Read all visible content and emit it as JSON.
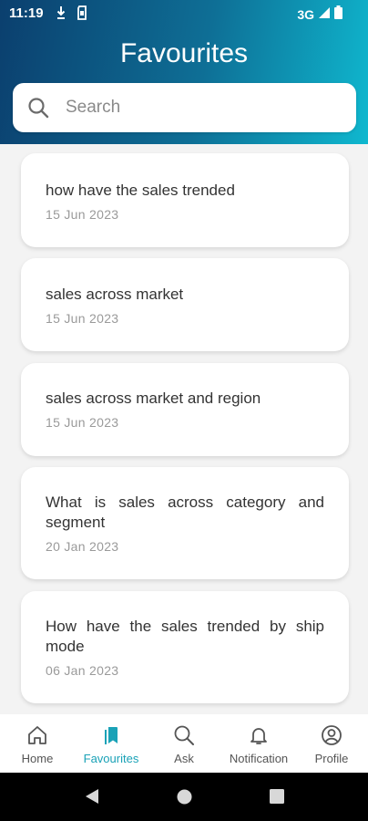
{
  "status_bar": {
    "time": "11:19",
    "network": "3G"
  },
  "header": {
    "title": "Favourites"
  },
  "search": {
    "placeholder": "Search",
    "value": ""
  },
  "favourites": [
    {
      "title": "how have the sales trended",
      "date": "15 Jun 2023"
    },
    {
      "title": "sales across market",
      "date": "15 Jun 2023"
    },
    {
      "title": "sales across market and region",
      "date": "15 Jun 2023"
    },
    {
      "title": "What is sales across category and segment",
      "date": "20 Jan 2023"
    },
    {
      "title": "How have the sales trended by ship mode",
      "date": "06 Jan 2023"
    }
  ],
  "bottom_nav": [
    {
      "label": "Home",
      "icon": "home-icon",
      "active": false
    },
    {
      "label": "Favourites",
      "icon": "bookmark-icon",
      "active": true
    },
    {
      "label": "Ask",
      "icon": "search-icon",
      "active": false
    },
    {
      "label": "Notification",
      "icon": "bell-icon",
      "active": false
    },
    {
      "label": "Profile",
      "icon": "profile-icon",
      "active": false
    }
  ],
  "colors": {
    "header_start": "#0b3f6e",
    "header_end": "#0fb8cf",
    "active": "#1aa2b7"
  }
}
